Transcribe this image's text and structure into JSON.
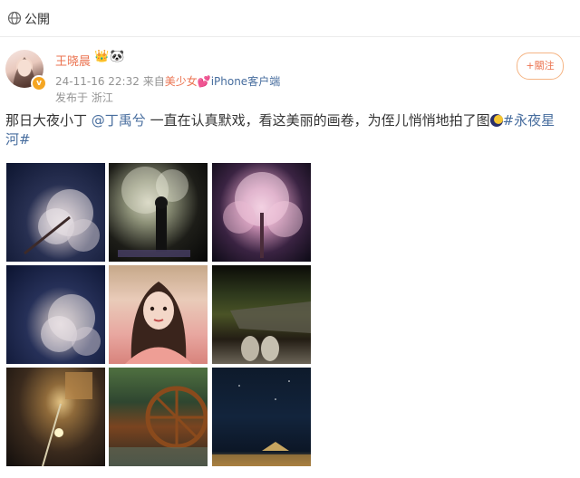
{
  "header": {
    "visibility_label": "公開",
    "visibility_icon": "globe-icon"
  },
  "post": {
    "author": {
      "name": "王晓晨",
      "badges": "👑🐼",
      "verified_icon": "verified-badge-icon"
    },
    "timestamp": "24-11-16 22:32",
    "source_prefix": "来自",
    "source_name": "美少女",
    "source_emoji": "💕",
    "source_device": "iPhone客户端",
    "location": "发布于 浙江",
    "follow_label": "+關注",
    "text": {
      "part1": "那日大夜小丁 ",
      "mention": "@丁禹兮",
      "part2": " 一直在认真默戏，看这美丽的画卷，为侄儿悄悄地拍了图",
      "emoji_icon": "moon-emoji-icon",
      "hashtag": "#永夜星河#"
    },
    "photos": [
      {
        "name": "photo-blossom-tree-night",
        "interactable": true
      },
      {
        "name": "photo-person-under-tree",
        "interactable": true
      },
      {
        "name": "photo-pink-blossom-tree",
        "interactable": true
      },
      {
        "name": "photo-blossom-tree-night-2",
        "interactable": true
      },
      {
        "name": "photo-selfie-costume",
        "interactable": true
      },
      {
        "name": "photo-boardwalk-night",
        "interactable": true
      },
      {
        "name": "photo-night-lights",
        "interactable": true
      },
      {
        "name": "photo-waterwheel",
        "interactable": true
      },
      {
        "name": "photo-night-sky-lights",
        "interactable": true
      }
    ]
  },
  "colors": {
    "accent_orange": "#eb7350",
    "link_blue": "#476d9e",
    "meta_gray": "#939393",
    "verified_gold": "#f5a623"
  }
}
